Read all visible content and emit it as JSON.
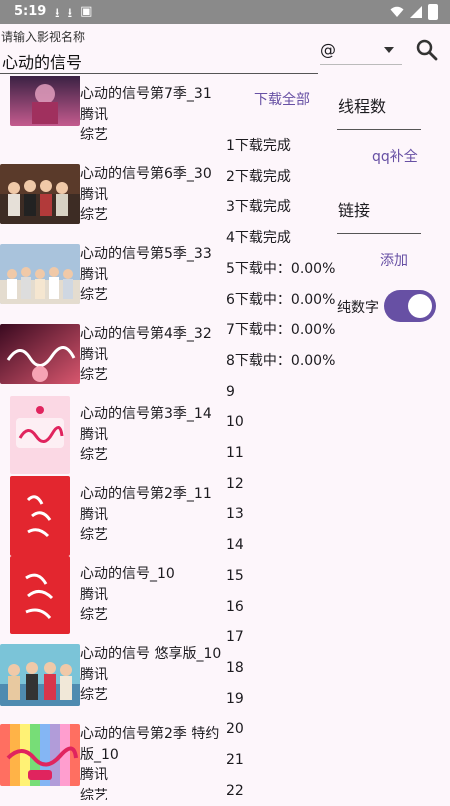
{
  "status_bar": {
    "time": "5:19"
  },
  "search": {
    "hint": "请输入影视名称",
    "value": "心动的信号",
    "site": "@"
  },
  "list": [
    {
      "title": "心动的信号第7季_31",
      "source": "腾讯",
      "category": "综艺"
    },
    {
      "title": "心动的信号第6季_30",
      "source": "腾讯",
      "category": "综艺"
    },
    {
      "title": "心动的信号第5季_33",
      "source": "腾讯",
      "category": "综艺"
    },
    {
      "title": "心动的信号第4季_32",
      "source": "腾讯",
      "category": "综艺"
    },
    {
      "title": "心动的信号第3季_14",
      "source": "腾讯",
      "category": "综艺"
    },
    {
      "title": "心动的信号第2季_11",
      "source": "腾讯",
      "category": "综艺"
    },
    {
      "title": "心动的信号_10",
      "source": "腾讯",
      "category": "综艺"
    },
    {
      "title": "心动的信号 悠享版_10",
      "source": "腾讯",
      "category": "综艺"
    },
    {
      "title": "心动的信号第2季 特约",
      "title2": "版_10",
      "source": "腾讯",
      "category": "综艺"
    }
  ],
  "download": {
    "all_label": "下载全部",
    "statuses": [
      "1下载完成",
      "2下载完成",
      "3下载完成",
      "4下载完成",
      "5下载中：0.00%",
      "6下载中：0.00%",
      "7下载中：0.00%",
      "8下载中：0.00%",
      "9",
      "10",
      "11",
      "12",
      "13",
      "14",
      "15",
      "16",
      "17",
      "18",
      "19",
      "20",
      "21",
      "22"
    ]
  },
  "right_panel": {
    "threads_label": "线程数",
    "qq_button": "qq补全",
    "link_label": "链接",
    "add_button": "添加",
    "digits_label": "纯数字",
    "digits_on": true
  }
}
